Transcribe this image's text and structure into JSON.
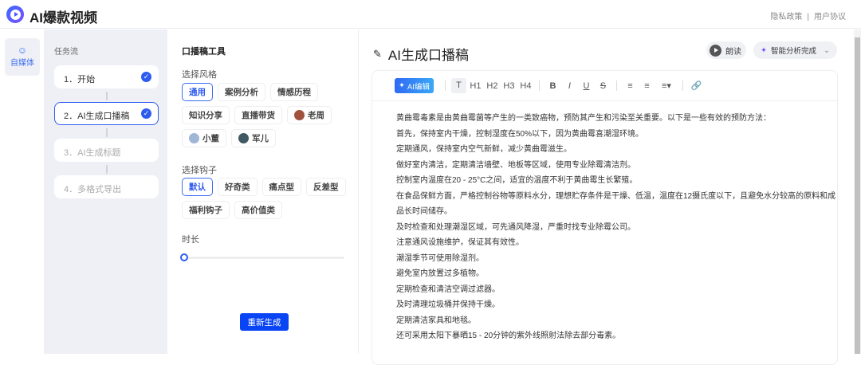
{
  "header": {
    "brand": "AI爆款视频",
    "links": [
      "隐私政策",
      "|",
      "用户协议"
    ]
  },
  "nav": {
    "item": "自媒体"
  },
  "flow": {
    "title": "任务流",
    "steps": [
      {
        "label": "1．开始",
        "done": true
      },
      {
        "label": "2．AI生成口播稿",
        "done": true,
        "active": true
      },
      {
        "label": "3．AI生成标题",
        "done": false
      },
      {
        "label": "4．多格式导出",
        "done": false
      }
    ]
  },
  "tool": {
    "title": "口播稿工具",
    "style_label": "选择风格",
    "styles": [
      "通用",
      "案例分析",
      "情感历程",
      "知识分享",
      "直播带货",
      "老周",
      "小董",
      "军儿"
    ],
    "hook_label": "选择钩子",
    "hooks": [
      "默认",
      "好奇类",
      "痛点型",
      "反差型",
      "福利钩子",
      "高价值类"
    ],
    "duration_label": "时长",
    "duration_value": 0,
    "regen": "重新生成"
  },
  "main": {
    "title": "AI生成口播稿",
    "read": "朗读",
    "analysis": "智能分析完成",
    "toolbar": {
      "ai_edit": "AI编辑",
      "buttons": [
        "T",
        "H1",
        "H2",
        "H3",
        "H4",
        "B",
        "I",
        "U",
        "S"
      ]
    },
    "lines": [
      "黄曲霉毒素是由黄曲霉菌等产生的一类致癌物，预防其产生和污染至关重要。以下是一些有效的预防方法：",
      "首先，保持室内干燥，控制湿度在50%以下，因为黄曲霉喜潮湿环境。",
      "定期通风，保持室内空气新鲜，减少黄曲霉滋生。",
      "做好室内清洁，定期清洁墙壁、地板等区域，使用专业除霉清洁剂。",
      "控制室内温度在20 - 25°C之间，适宜的温度不利于黄曲霉生长繁殖。",
      "在食品保鲜方面，严格控制谷物等原料水分，理想贮存条件是干燥、低温，温度在12摄氏度以下，且避免水分较高的原料和成品长时间储存。",
      "及时检查和处理潮湿区域，可先通风降湿，严重时找专业除霉公司。",
      "注意通风设施维护，保证其有效性。",
      "潮湿季节可使用除湿剂。",
      "避免室内放置过多植物。",
      "定期检查和清洁空调过滤器。",
      "及时清理垃圾桶并保持干燥。",
      "定期清洁家具和地毯。",
      "还可采用太阳下暴晒15 - 20分钟的紫外线照射法除去部分毒素。"
    ]
  }
}
